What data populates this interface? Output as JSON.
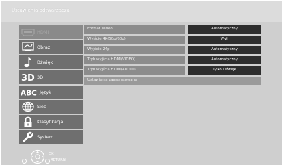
{
  "window": {
    "title": "Ustawienia odtwarzacza"
  },
  "sidebar": {
    "items": [
      {
        "label": "HDMI",
        "icon": "hdmi-icon",
        "disabled": true
      },
      {
        "label": "Obraz",
        "icon": "picture-icon",
        "disabled": false
      },
      {
        "label": "Dźwięk",
        "icon": "music-note-icon",
        "disabled": false
      },
      {
        "label": "3D",
        "icon": "3d-icon",
        "disabled": false
      },
      {
        "label": "Język",
        "icon": "abc-icon",
        "disabled": false
      },
      {
        "label": "Sieć",
        "icon": "globe-icon",
        "disabled": false
      },
      {
        "label": "Klasyfikacja",
        "icon": "lock-icon",
        "disabled": false
      },
      {
        "label": "System",
        "icon": "wrench-icon",
        "disabled": false
      }
    ]
  },
  "settings": {
    "rows": [
      {
        "name": "Format wideo",
        "value": "Automatyczny"
      },
      {
        "name": "Wyjście 4K(50p/60p)",
        "value": "Wył."
      },
      {
        "name": "Wyjście 24p",
        "value": "Automatyczny"
      },
      {
        "name": "Tryb wyjścia HDMI(VIDEO)",
        "value": "Automatyczny"
      },
      {
        "name": "Tryb wyjścia HDMI(AUDIO)",
        "value": "Tylko Dźwięk"
      },
      {
        "name": "Ustawienia zaawansowane",
        "value": ""
      }
    ]
  },
  "footer": {
    "ok_label": "OK",
    "return_label": "RETURN"
  },
  "colors": {
    "background": "#cfcfcf",
    "sidebar_item": "#6f6f6f",
    "row_name": "#8c8c8c",
    "row_value": "#2d2d2d"
  }
}
